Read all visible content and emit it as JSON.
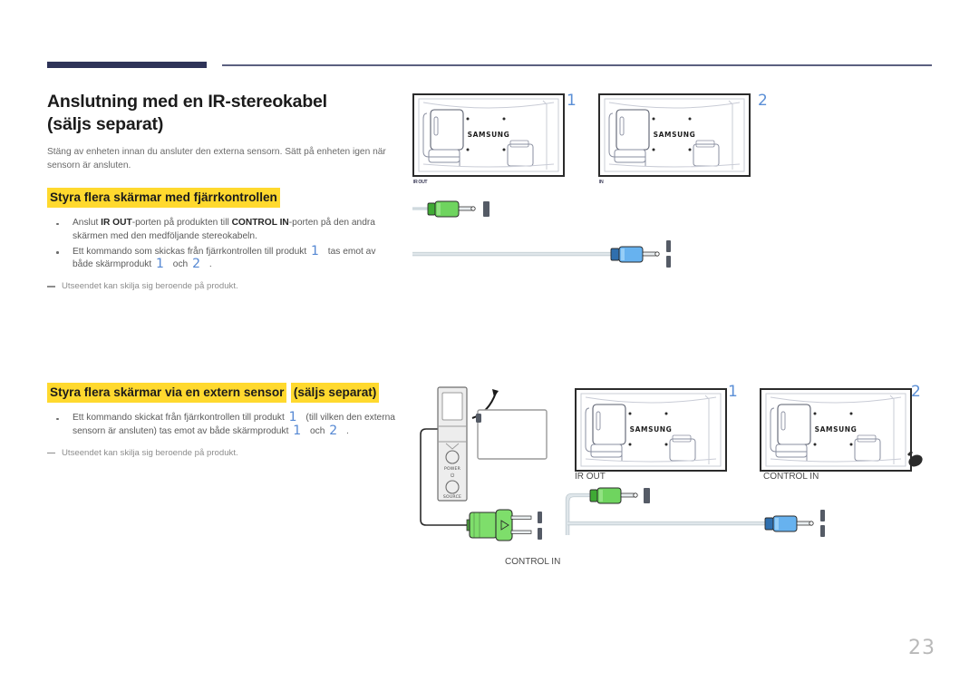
{
  "document": {
    "page_number": "23"
  },
  "header": {
    "rule_color": "#2e3358"
  },
  "section1": {
    "title_line1": "Anslutning med en IR-stereokabel",
    "title_line2": "(säljs separat)",
    "intro": "Stäng av enheten innan du ansluter den externa sensorn. Sätt på enheten igen när sensorn är ansluten.",
    "subhead": "Styra flera skärmar med fjärrkontrollen",
    "bullets": [
      {
        "p1": "Anslut ",
        "b1": "IR OUT",
        "p2": "-porten på produkten till ",
        "b2": "CONTROL IN",
        "p3": "-porten på den andra skärmen med den medföljande stereokabeln."
      },
      {
        "p1": "Ett kommando som skickas från fjärrkontrollen till produkt ",
        "n1": "1",
        "p2": " tas emot av både skärmprodukt ",
        "n2": "1",
        "p3": " och ",
        "n3": "2",
        "p4": " ."
      }
    ],
    "note": "Utseendet kan skilja sig beroende på produkt."
  },
  "section2": {
    "subhead_line1": "Styra flera skärmar via en extern sensor",
    "subhead_line2": "(säljs separat)",
    "bullet": {
      "p1": "Ett kommando skickat från fjärrkontrollen till produkt ",
      "n1": "1",
      "p2": " (till vilken den externa sensorn är ansluten) tas emot av både skärmprodukt ",
      "n2": "1",
      "p3": " och ",
      "n3": "2",
      "p4": " ."
    },
    "note": "Utseendet kan skilja sig beroende på produkt."
  },
  "diagram_top": {
    "monitor1": {
      "brand": "SAMSUNG",
      "index": "1",
      "port_label": "IR OUT"
    },
    "monitor2": {
      "brand": "SAMSUNG",
      "index": "2",
      "port_label": "IN"
    },
    "cable": {
      "plug_out_color": "#62c455",
      "plug_in_color": "#5aa8e8"
    }
  },
  "diagram_bottom": {
    "sensor": {
      "power_label": "POWER",
      "source_label": "SOURCE",
      "connector_color": "#7ede6b"
    },
    "monitor1": {
      "brand": "SAMSUNG",
      "index": "1",
      "port_label": "IR OUT"
    },
    "monitor2": {
      "brand": "SAMSUNG",
      "index": "2",
      "port_label": "CONTROL IN"
    },
    "cable_label": "CONTROL IN",
    "cable": {
      "plug_out_color": "#62c455",
      "plug_in_color": "#5aa8e8"
    }
  },
  "colors": {
    "highlight": "#ffd92e",
    "accent_number": "#5588d3",
    "header_bar": "#2e3358"
  }
}
